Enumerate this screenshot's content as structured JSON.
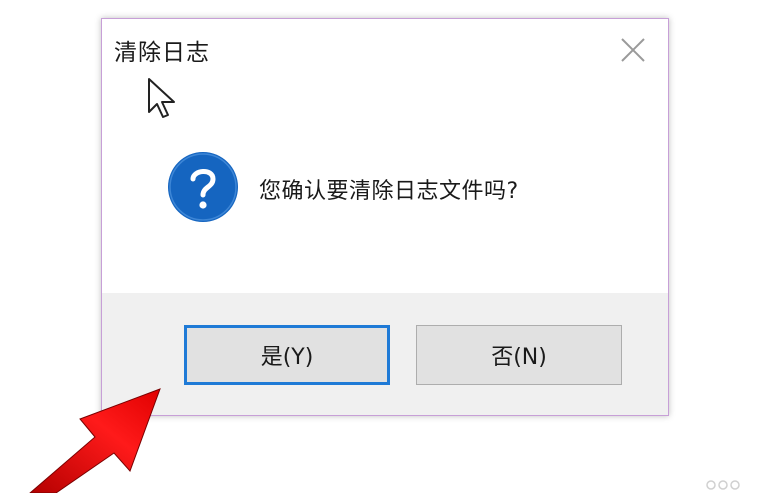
{
  "dialog": {
    "title": "清除日志",
    "message": "您确认要清除日志文件吗?",
    "yes_label": "是(Y)",
    "no_label": "否(N)"
  },
  "icons": {
    "close": "close-icon",
    "question": "question-icon",
    "cursor": "mouse-pointer-icon",
    "arrow": "red-arrow-annotation"
  },
  "colors": {
    "accent": "#1f7ad6",
    "question_icon": "#1565c0",
    "arrow": "#e00000",
    "dialog_border": "#c79fd7"
  }
}
